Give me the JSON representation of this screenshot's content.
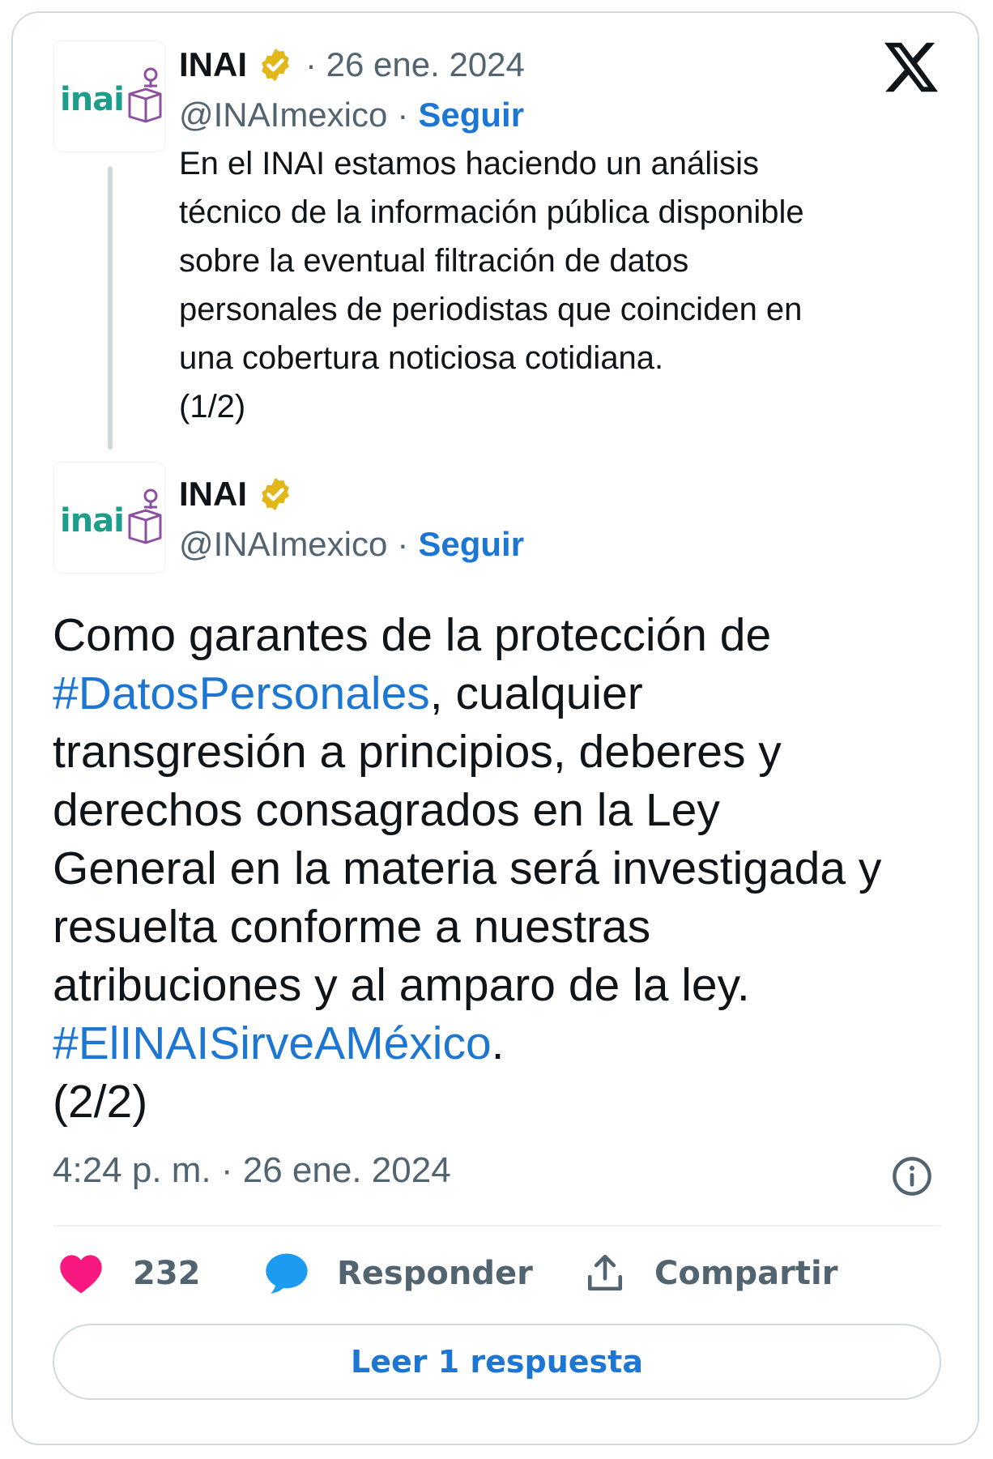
{
  "colors": {
    "link": "#1d77d2",
    "text": "#0f1419",
    "secondary": "#536471",
    "like": "#f91880",
    "reply": "#1d9bf0",
    "verified": "#e2b719",
    "brand_teal": "#1d9e8a",
    "brand_purple": "#8e4f9f"
  },
  "platform_logo": "x-logo-icon",
  "tweet1": {
    "avatar_text": "inai",
    "name": "INAI",
    "date": "· 26 ene. 2024",
    "handle": "@INAImexico",
    "separator": "·",
    "follow": "Seguir",
    "text_lines": [
      "En el INAI estamos haciendo un análisis",
      "técnico de la información pública disponible",
      "sobre la eventual filtración de datos",
      "personales de periodistas que coinciden en",
      "una cobertura noticiosa cotidiana.",
      "(1/2)"
    ]
  },
  "tweet2": {
    "avatar_text": "inai",
    "name": "INAI",
    "handle": "@INAImexico",
    "separator": "·",
    "follow": "Seguir",
    "line1": "Como garantes de la protección de",
    "hashtag1": "#DatosPersonales",
    "line2_rest": ", cualquier",
    "line3": "transgresión a principios, deberes y",
    "line4": "derechos consagrados en la Ley",
    "line5": "General en la materia será investigada y",
    "line6": "resuelta conforme a nuestras",
    "line7": "atribuciones y al amparo de la ley.",
    "hashtag2": "#ElINAISirveAMéxico",
    "line8_rest": ".",
    "line9": "(2/2)",
    "timestamp": "4:24 p. m. · 26 ene. 2024"
  },
  "actions": {
    "likes": "232",
    "reply": "Responder",
    "share": "Compartir"
  },
  "read_replies": "Leer 1 respuesta"
}
